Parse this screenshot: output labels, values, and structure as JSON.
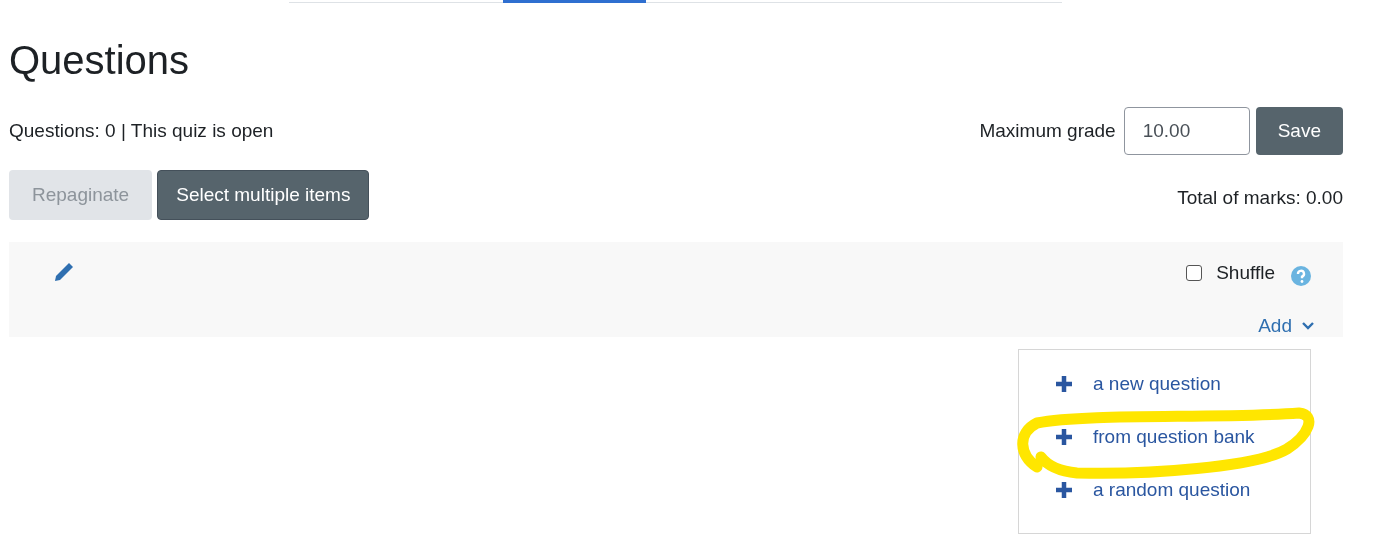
{
  "tabs_bar": {
    "active": true
  },
  "heading": "Questions",
  "info": "Questions: 0 | This quiz is open",
  "max_grade": {
    "label": "Maximum grade",
    "value": "10.00",
    "button": "Save"
  },
  "buttons": [
    {
      "label": "Repaginate",
      "disabled": true
    },
    {
      "label": "Select multiple items",
      "disabled": false
    }
  ],
  "total": "Total of marks: 0.00",
  "section": {
    "shuffle": {
      "label": "Shuffle",
      "checked": false
    },
    "add": {
      "label": "Add",
      "expanded": true
    }
  },
  "add_menu": [
    {
      "label": "a new question",
      "highlighted": false
    },
    {
      "label": "from question bank",
      "highlighted": true
    },
    {
      "label": "a random question",
      "highlighted": false
    }
  ]
}
